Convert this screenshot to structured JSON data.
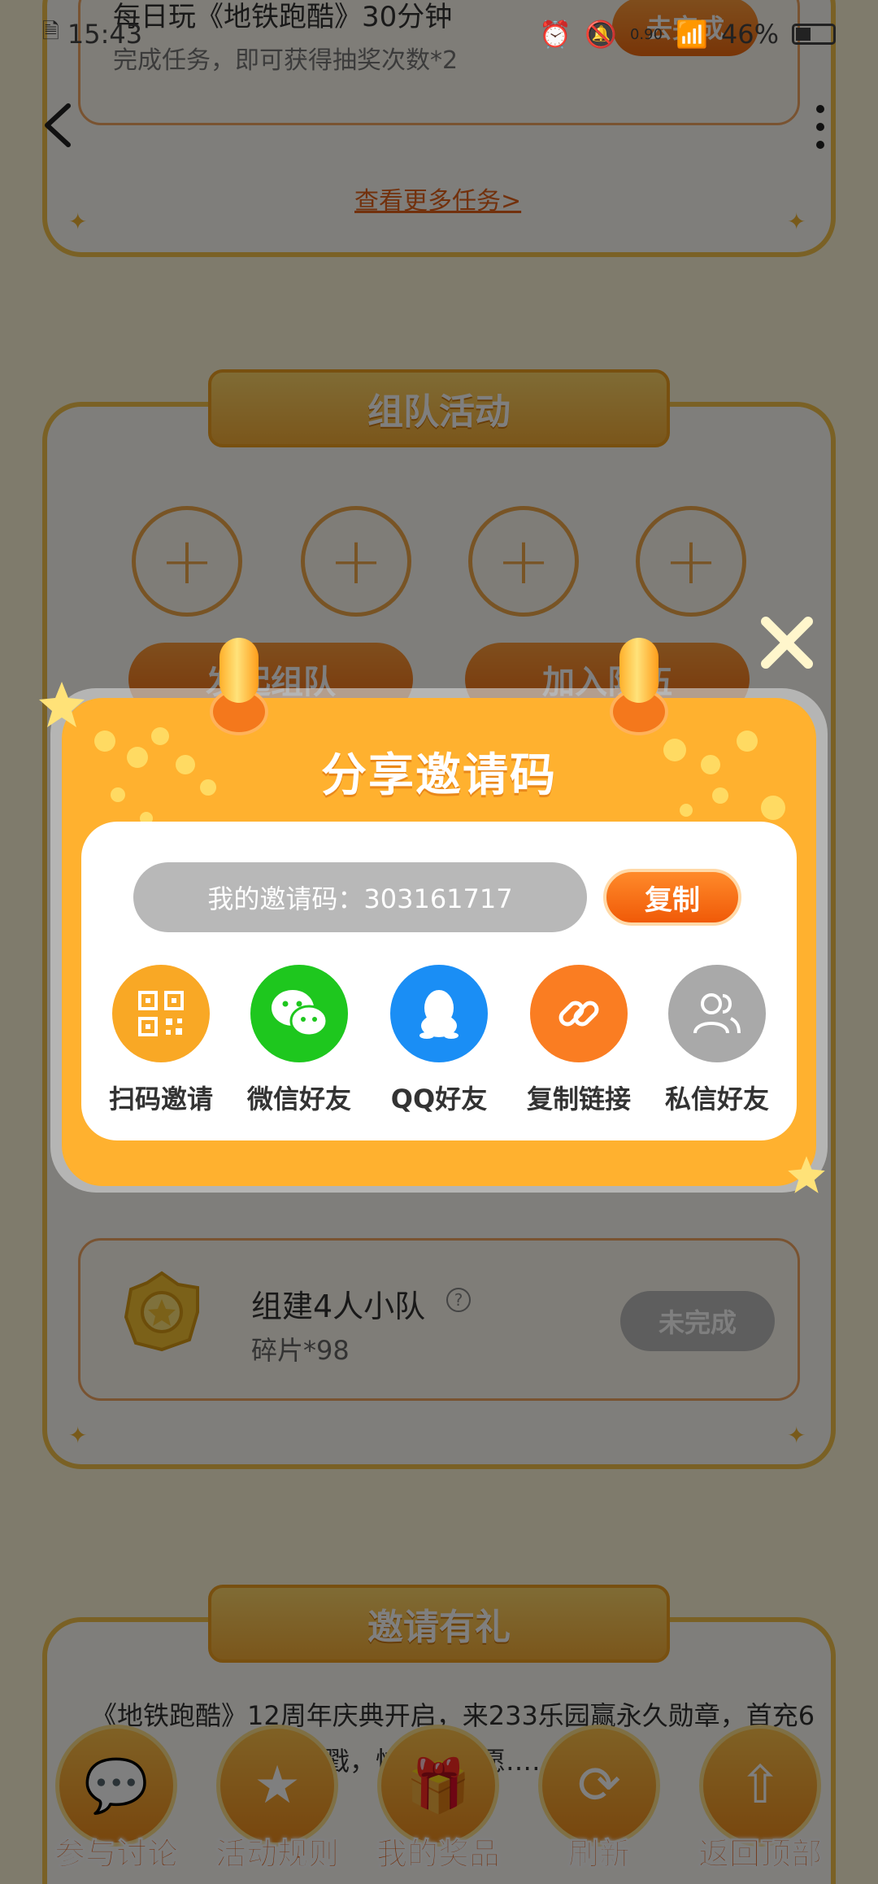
{
  "status_bar": {
    "time": "15:43",
    "battery": "46%",
    "network": "0.90"
  },
  "top_task": {
    "title": "每日玩《地铁跑酷》30分钟",
    "subtitle": "完成任务，即可获得抽奖次数*2",
    "button": "去完成",
    "more_link": "查看更多任务>"
  },
  "team_section": {
    "title": "组队活动",
    "create_button": "发起组队",
    "join_button": "加入队伍",
    "task_title": "组建4人小队",
    "task_reward": "碎片*98",
    "task_status": "未完成"
  },
  "invite_section": {
    "title": "邀请有礼",
    "text_line1": "《地铁跑酷》12周年庆典开启，来233乐园赢永久勋章，首充6",
    "text_line2": "元……戳，快……！愿……"
  },
  "modal": {
    "title": "分享邀请码",
    "code_label": "我的邀请码：303161717",
    "copy_button": "复制",
    "share_options": [
      {
        "label": "扫码邀请",
        "icon": "qr-code-icon",
        "color": "#f9a825"
      },
      {
        "label": "微信好友",
        "icon": "wechat-icon",
        "color": "#1ec71e"
      },
      {
        "label": "QQ好友",
        "icon": "qq-icon",
        "color": "#1a8ef5"
      },
      {
        "label": "复制链接",
        "icon": "link-icon",
        "color": "#fa7d22"
      },
      {
        "label": "私信好友",
        "icon": "friends-icon",
        "color": "#a9a9a9"
      }
    ]
  },
  "bottom_nav": [
    {
      "label": "参与讨论",
      "icon": "chat-icon"
    },
    {
      "label": "活动规则",
      "icon": "rules-icon"
    },
    {
      "label": "我的奖品",
      "icon": "gift-icon"
    },
    {
      "label": "刷新",
      "icon": "refresh-icon"
    },
    {
      "label": "返回顶部",
      "icon": "back-to-top-icon"
    }
  ],
  "colors": {
    "accent": "#ffb12f",
    "brand_orange": "#f05a08",
    "overlay": "rgba(0,0,0,0.5)"
  }
}
